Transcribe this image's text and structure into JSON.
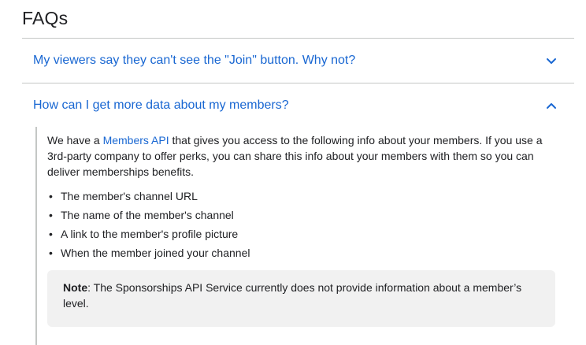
{
  "faq": {
    "heading": "FAQs",
    "items": [
      {
        "question": "My viewers say they can't see the \"Join\" button. Why not?",
        "expanded": false,
        "icon": "chevron-down-icon"
      },
      {
        "question": "How can I get more data about my members?",
        "expanded": true,
        "icon": "chevron-up-icon",
        "answer": {
          "intro_before": "We have a ",
          "link_text": "Members API",
          "intro_after": " that gives you access to the following info about your members. If you use a 3rd-party company to offer perks, you can share this info about your members with them so you can deliver memberships benefits.",
          "bullet_char": "•",
          "bullets": [
            "The member's channel URL",
            "The name of the member's channel",
            "A link to the member's profile picture",
            "When the member joined your channel"
          ],
          "note_label": "Note",
          "note_text": ": The Sponsorships API Service currently does not provide information about a member’s level."
        }
      }
    ]
  },
  "colors": {
    "link": "#1967d2",
    "text": "#202124",
    "divider": "#c4c7c5",
    "note_bg": "#f1f1f1"
  }
}
